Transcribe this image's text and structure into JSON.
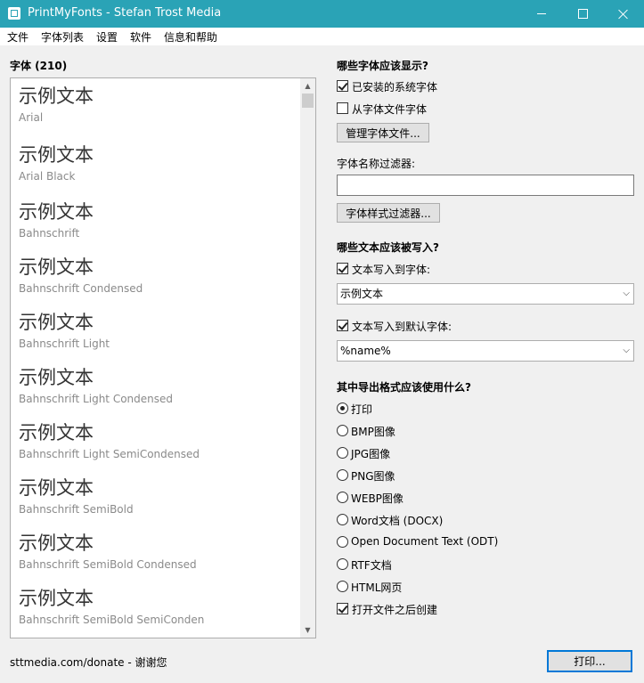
{
  "window": {
    "title": "PrintMyFonts - Stefan Trost Media"
  },
  "menu": [
    "文件",
    "字体列表",
    "设置",
    "软件",
    "信息和帮助"
  ],
  "font_list": {
    "header": "字体 (210)",
    "sample_text": "示例文本",
    "fonts": [
      "Arial",
      "Arial Black",
      "Bahnschrift",
      "Bahnschrift Condensed",
      "Bahnschrift Light",
      "Bahnschrift Light Condensed",
      "Bahnschrift Light SemiCondensed",
      "Bahnschrift SemiBold",
      "Bahnschrift SemiBold Condensed",
      "Bahnschrift SemiBold SemiConden"
    ]
  },
  "display": {
    "heading": "哪些字体应该显示?",
    "installed_label": "已安装的系统字体",
    "installed_checked": true,
    "from_files_label": "从字体文件字体",
    "from_files_checked": false,
    "manage_button": "管理字体文件...",
    "name_filter_label": "字体名称过滤器:",
    "name_filter_value": "",
    "style_filter_button": "字体样式过滤器..."
  },
  "text": {
    "heading": "哪些文本应该被写入?",
    "write_to_font_label": "文本写入到字体:",
    "write_to_font_checked": true,
    "font_text_value": "示例文本",
    "write_default_label": "文本写入到默认字体:",
    "write_default_checked": true,
    "default_text_value": "%name%"
  },
  "export": {
    "heading": "其中导出格式应该使用什么?",
    "options": [
      "打印",
      "BMP图像",
      "JPG图像",
      "PNG图像",
      "WEBP图像",
      "Word文档 (DOCX)",
      "Open Document Text (ODT)",
      "RTF文档",
      "HTML网页"
    ],
    "selected": "打印",
    "open_after_label": "打开文件之后创建",
    "open_after_checked": true
  },
  "footer": {
    "donate_text": "sttmedia.com/donate - 谢谢您",
    "print_button": "打印..."
  }
}
